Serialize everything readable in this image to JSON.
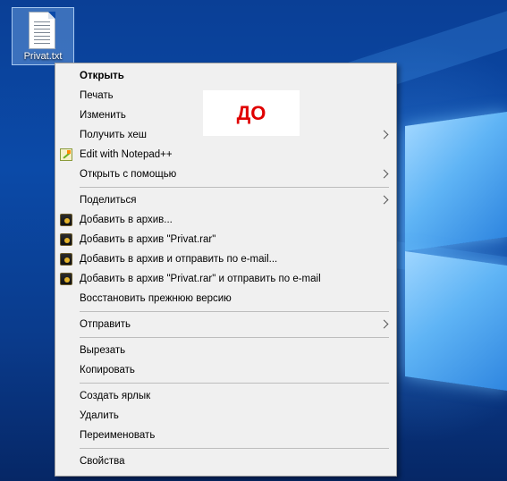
{
  "desktop": {
    "file_icon": {
      "name": "Privat.txt"
    }
  },
  "badge": {
    "text": "ДО"
  },
  "menu": {
    "groups": [
      [
        {
          "label": "Открыть",
          "bold": true,
          "icon": "",
          "submenu": false
        },
        {
          "label": "Печать",
          "bold": false,
          "icon": "",
          "submenu": false
        },
        {
          "label": "Изменить",
          "bold": false,
          "icon": "",
          "submenu": false
        },
        {
          "label": "Получить хеш",
          "bold": false,
          "icon": "",
          "submenu": true
        },
        {
          "label": "Edit with Notepad++",
          "bold": false,
          "icon": "notepadpp-icon",
          "submenu": false
        },
        {
          "label": "Открыть с помощью",
          "bold": false,
          "icon": "",
          "submenu": true
        }
      ],
      [
        {
          "label": "Поделиться",
          "bold": false,
          "icon": "",
          "submenu": true
        },
        {
          "label": "Добавить в архив...",
          "bold": false,
          "icon": "winrar-icon",
          "submenu": false
        },
        {
          "label": "Добавить в архив \"Privat.rar\"",
          "bold": false,
          "icon": "winrar-icon",
          "submenu": false
        },
        {
          "label": "Добавить в архив и отправить по e-mail...",
          "bold": false,
          "icon": "winrar-icon",
          "submenu": false
        },
        {
          "label": "Добавить в архив \"Privat.rar\" и отправить по e-mail",
          "bold": false,
          "icon": "winrar-icon",
          "submenu": false
        },
        {
          "label": "Восстановить прежнюю версию",
          "bold": false,
          "icon": "",
          "submenu": false
        }
      ],
      [
        {
          "label": "Отправить",
          "bold": false,
          "icon": "",
          "submenu": true
        }
      ],
      [
        {
          "label": "Вырезать",
          "bold": false,
          "icon": "",
          "submenu": false
        },
        {
          "label": "Копировать",
          "bold": false,
          "icon": "",
          "submenu": false
        }
      ],
      [
        {
          "label": "Создать ярлык",
          "bold": false,
          "icon": "",
          "submenu": false
        },
        {
          "label": "Удалить",
          "bold": false,
          "icon": "",
          "submenu": false
        },
        {
          "label": "Переименовать",
          "bold": false,
          "icon": "",
          "submenu": false
        }
      ],
      [
        {
          "label": "Свойства",
          "bold": false,
          "icon": "",
          "submenu": false
        }
      ]
    ]
  }
}
